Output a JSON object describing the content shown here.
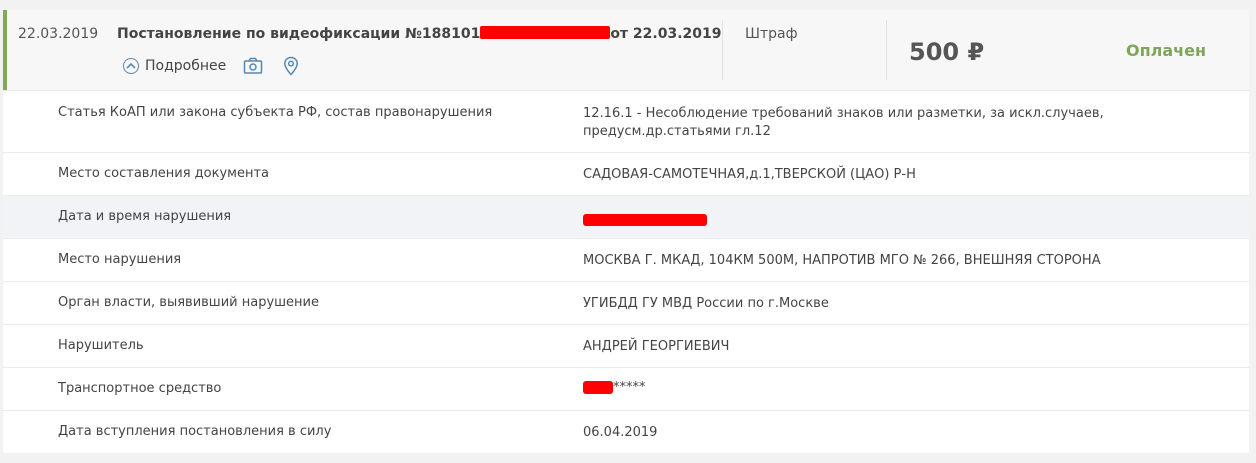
{
  "header": {
    "date": "22.03.2019",
    "title_prefix": "Постановление по видеофиксации №188101",
    "title_suffix": "от 22.03.2019",
    "more_label": "Подробнее",
    "icons": [
      "chevron-up-icon",
      "camera-icon",
      "map-pin-icon"
    ],
    "type": "Штраф",
    "amount": "500 ₽",
    "status": "Оплачен"
  },
  "colors": {
    "accent": "#82a85a",
    "status": "#7ea55a",
    "icon": "#5b86b0",
    "redaction": "#ff0000"
  },
  "details": [
    {
      "label": "Статья КоАП или закона субъекта РФ, состав правонарушения",
      "value": "12.16.1 - Несоблюдение требований знаков или разметки, за искл.случаев, предусм.др.статьями гл.12"
    },
    {
      "label": "Место составления документа",
      "value": "САДОВАЯ-САМОТЕЧНАЯ,д.1,ТВЕРСКОЙ (ЦАО) Р-Н"
    },
    {
      "label": "Дата и время нарушения",
      "value": ""
    },
    {
      "label": "Место нарушения",
      "value": "МОСКВА Г. МКАД, 104КМ 500М, НАПРОТИВ МГО № 266, ВНЕШНЯЯ СТОРОНА"
    },
    {
      "label": "Орган власти, выявивший нарушение",
      "value": "УГИБДД ГУ МВД России по г.Москве"
    },
    {
      "label": "Нарушитель",
      "value": "АНДРЕЙ ГЕОРГИЕВИЧ"
    },
    {
      "label": "Транспортное средство",
      "value": "*****"
    },
    {
      "label": "Дата вступления постановления в силу",
      "value": "06.04.2019"
    }
  ]
}
